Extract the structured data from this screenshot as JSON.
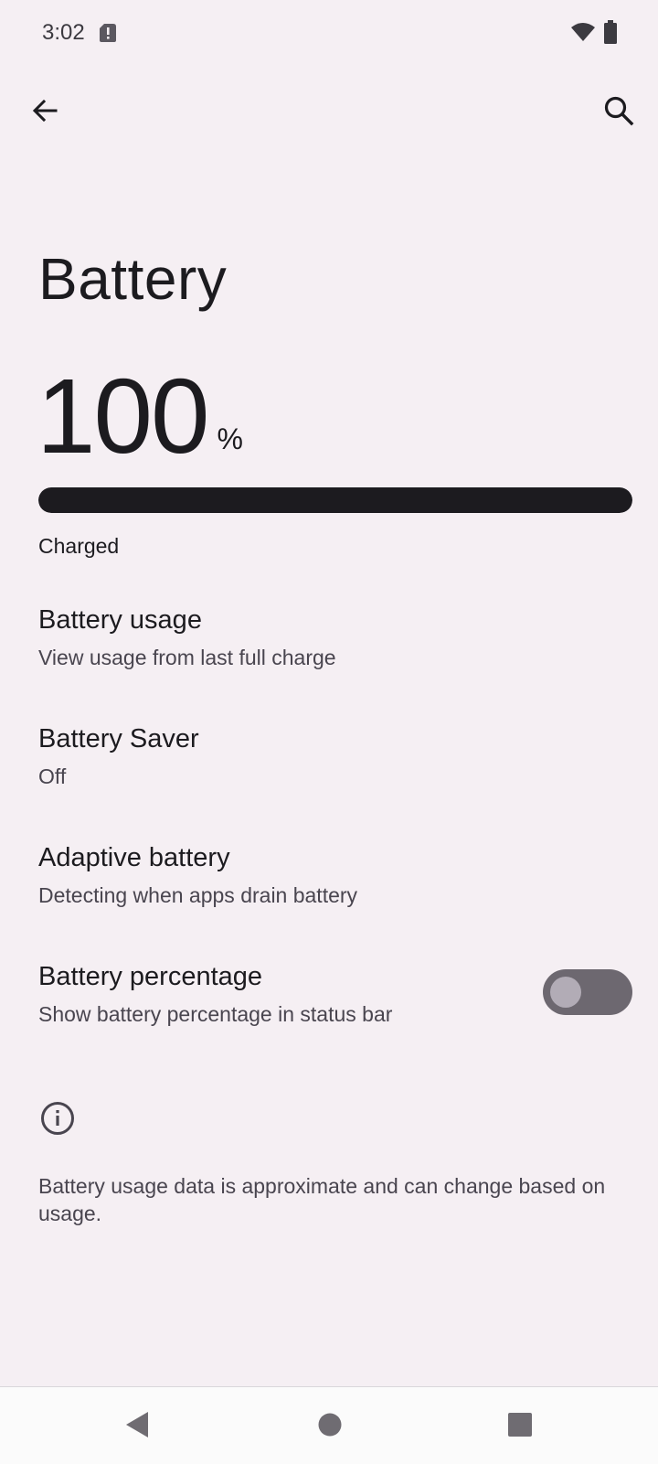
{
  "status_bar": {
    "time": "3:02",
    "icons": [
      "sim-alert-icon",
      "wifi-icon",
      "battery-icon"
    ]
  },
  "top_bar": {
    "back_icon": "arrow-left-icon",
    "search_icon": "search-icon"
  },
  "page": {
    "title": "Battery"
  },
  "battery": {
    "level_value": "100",
    "level_unit": "%",
    "level_fraction": 1.0,
    "status": "Charged"
  },
  "preferences": [
    {
      "title": "Battery usage",
      "summary": "View usage from last full charge"
    },
    {
      "title": "Battery Saver",
      "summary": "Off"
    },
    {
      "title": "Adaptive battery",
      "summary": "Detecting when apps drain battery"
    },
    {
      "title": "Battery percentage",
      "summary": "Show battery percentage in status bar",
      "toggle_on": false
    }
  ],
  "footer": {
    "info_icon": "info-icon",
    "text": "Battery usage data is approximate and can change based on usage."
  },
  "nav_bar": {
    "icons": [
      "nav-back-icon",
      "nav-home-icon",
      "nav-recents-icon"
    ]
  },
  "colors": {
    "background": "#f5eff3",
    "text_primary": "#1c1b1f",
    "text_secondary": "#49454f",
    "meter_fill": "#1c1b1f",
    "toggle_track_off": "#6d6870",
    "toggle_thumb_off": "#b2acb6"
  }
}
